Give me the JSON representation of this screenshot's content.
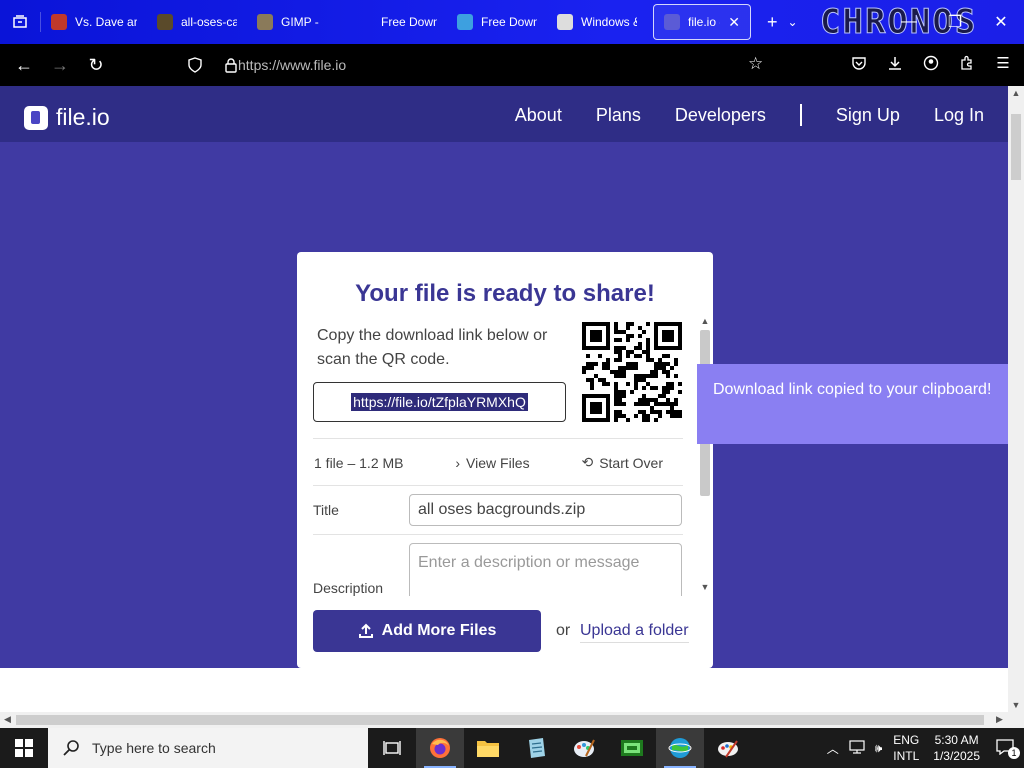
{
  "browser": {
    "tabs": [
      {
        "label": "Vs. Dave ar",
        "fav_color": "#c0392b",
        "active": false
      },
      {
        "label": "all-oses-ca",
        "fav_color": "#5a4a2a",
        "active": false
      },
      {
        "label": "GIMP -",
        "fav_color": "#8a7a5a",
        "active": false
      },
      {
        "label": "Free Down",
        "fav_color": "",
        "active": false
      },
      {
        "label": "Free Down",
        "fav_color": "#3da0e0",
        "active": false
      },
      {
        "label": "Windows &",
        "fav_color": "#dddddd",
        "active": false
      },
      {
        "label": "file.io - \\",
        "fav_color": "#5b5bd6",
        "active": true
      }
    ],
    "watermark": "CHRONOS",
    "url": "https://www.file.io"
  },
  "site": {
    "logo_text": "file.io",
    "nav": {
      "about": "About",
      "plans": "Plans",
      "developers": "Developers",
      "sign_up": "Sign Up",
      "log_in": "Log In"
    }
  },
  "card": {
    "title": "Your file is ready to share!",
    "instruction": "Copy the download link below or scan the QR code.",
    "link": "https://file.io/tZfplaYRMXhQ",
    "file_count": "1 file – 1.2 MB",
    "view_files": "View Files",
    "start_over": "Start Over",
    "title_label": "Title",
    "title_value": "all oses bacgrounds.zip",
    "description_label": "Description",
    "description_placeholder": "Enter a description or message",
    "add_more": "Add More Files",
    "or": "or",
    "upload_folder": "Upload a folder"
  },
  "toast": {
    "message": "Download link copied to your clipboard!"
  },
  "taskbar": {
    "search_placeholder": "Type here to search",
    "lang_top": "ENG",
    "lang_bottom": "INTL",
    "time": "5:30 AM",
    "date": "1/3/2025"
  },
  "colors": {
    "header": "#2f2d86",
    "hero": "#403aa3",
    "accent": "#3a3694",
    "toast": "#8a7ff2"
  }
}
